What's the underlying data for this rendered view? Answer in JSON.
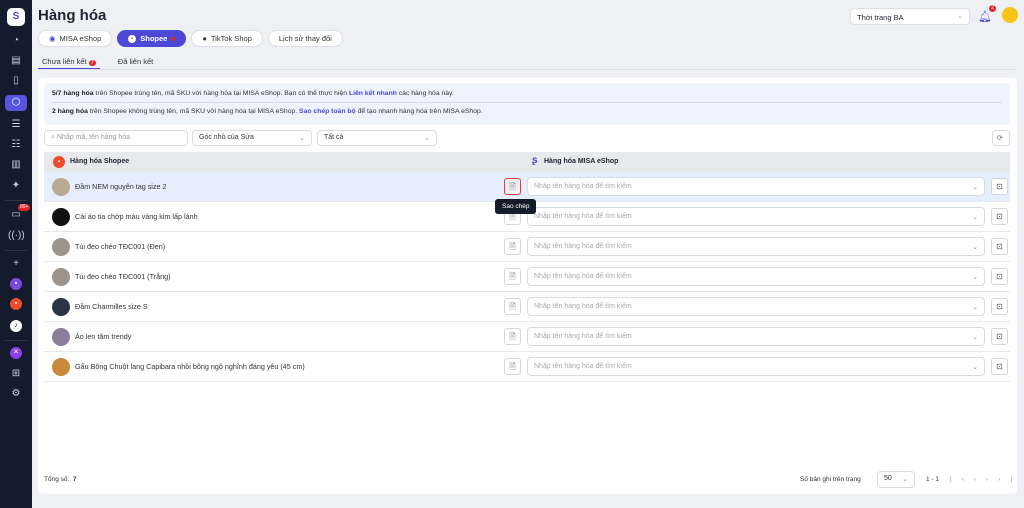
{
  "page": {
    "title": "Hàng hóa"
  },
  "header": {
    "store": "Thời trang BA",
    "notif_count": "2"
  },
  "sidebar": {
    "chat_badge": "99+"
  },
  "channels": [
    {
      "label": "MISA eShop"
    },
    {
      "label": "Shopee"
    },
    {
      "label": "TikTok Shop"
    },
    {
      "label": "Lịch sử thay đổi"
    }
  ],
  "subtabs": [
    {
      "label": "Chưa liên kết",
      "badge": "7"
    },
    {
      "label": "Đã liên kết"
    }
  ],
  "info": {
    "l1_b": "5/7 hàng hóa",
    "l1_t": " trên Shopee trùng tên, mã SKU với hàng hóa tại MISA eShop. Bạn có thể thực hiện ",
    "l1_a": "Liên kết nhanh",
    "l1_e": " các hàng hóa này.",
    "l2_b": "2 hàng hóa",
    "l2_t": " trên Shopee không trùng tên, mã SKU với hàng hóa tại MISA eShop. ",
    "l2_a": "Sao chép toàn bộ",
    "l2_e": " để tạo nhanh hàng hóa trên MISA eShop."
  },
  "filters": {
    "search_placeholder": "Nhập mã, tên hàng hóa",
    "category": "Góc nhỏ của Sứa",
    "status": "Tất cả"
  },
  "table": {
    "col1": "Hàng hóa Shopee",
    "col2": "Hàng hóa MISA eShop",
    "select_placeholder": "Nhập tên hàng hóa để tìm kiếm",
    "rows": [
      "Đầm NEM nguyên tag size 2",
      "Cái áo tia chớp màu vàng kim lấp lánh",
      "Túi đeo chéo TĐC001 (Đen)",
      "Túi đeo chéo TĐC001 (Trắng)",
      "Đầm Charmilles size S",
      "Áo len tăm trendy",
      "Gấu Bông Chuột lang Capibara nhồi bông ngộ nghĩnh đáng yêu (45 cm)"
    ]
  },
  "tooltip": "Sao chép",
  "footer": {
    "total_label": "Tổng số:",
    "total": "7",
    "per_page_label": "Số bản ghi trên trang",
    "per_page": "50",
    "range": "1 - 1"
  },
  "colors": {
    "accent": "#4b49d6",
    "sidebar": "#141b2d",
    "shopee": "#ee4d2d"
  }
}
